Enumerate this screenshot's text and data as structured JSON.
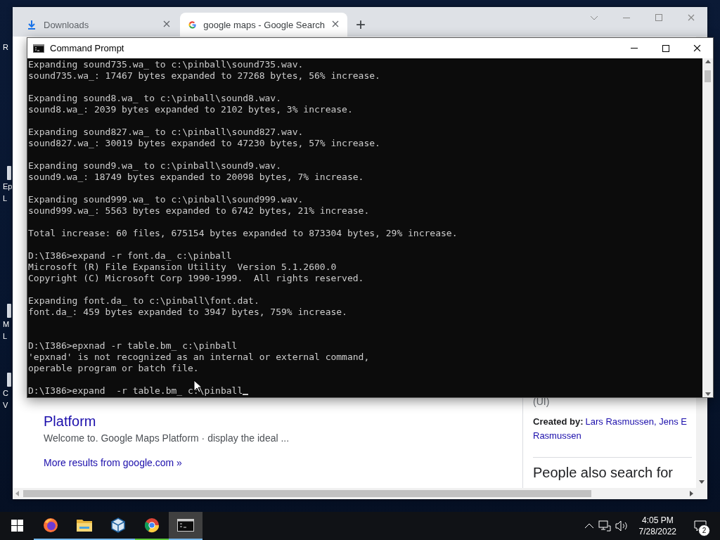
{
  "desktop_icons": [
    {
      "lines": [
        "R"
      ]
    },
    {
      "lines": [
        "Ep",
        "L"
      ]
    },
    {
      "lines": [
        "M",
        "L"
      ]
    },
    {
      "lines": [
        "C",
        "V"
      ]
    }
  ],
  "browser": {
    "tabs": [
      {
        "kind": "download",
        "title": "Downloads",
        "selected": false
      },
      {
        "kind": "google",
        "title": "google maps - Google Search",
        "selected": true
      }
    ],
    "new_tab": "+",
    "results": {
      "title": "Platform",
      "snippet": "Welcome to. Google Maps Platform · display the ideal ...",
      "more": "More results from google.com »"
    },
    "panel": {
      "note": "(UI)",
      "created_label": "Created by:",
      "creators": "Lars Rasmussen, Jens E",
      "creators_cont": "Rasmussen",
      "people_heading": "People also search for"
    }
  },
  "console": {
    "title": "Command Prompt",
    "lines": [
      {
        "kind": "text",
        "text": "Expanding sound735.wa_ to c:\\pinball\\sound735.wav."
      },
      {
        "kind": "text",
        "text": "sound735.wa_: 17467 bytes expanded to 27268 bytes, 56% increase."
      },
      {
        "kind": "blank"
      },
      {
        "kind": "text",
        "text": "Expanding sound8.wa_ to c:\\pinball\\sound8.wav."
      },
      {
        "kind": "text",
        "text": "sound8.wa_: 2039 bytes expanded to 2102 bytes, 3% increase."
      },
      {
        "kind": "blank"
      },
      {
        "kind": "text",
        "text": "Expanding sound827.wa_ to c:\\pinball\\sound827.wav."
      },
      {
        "kind": "text",
        "text": "sound827.wa_: 30019 bytes expanded to 47230 bytes, 57% increase."
      },
      {
        "kind": "blank"
      },
      {
        "kind": "text",
        "text": "Expanding sound9.wa_ to c:\\pinball\\sound9.wav."
      },
      {
        "kind": "text",
        "text": "sound9.wa_: 18749 bytes expanded to 20098 bytes, 7% increase."
      },
      {
        "kind": "blank"
      },
      {
        "kind": "text",
        "text": "Expanding sound999.wa_ to c:\\pinball\\sound999.wav."
      },
      {
        "kind": "text",
        "text": "sound999.wa_: 5563 bytes expanded to 6742 bytes, 21% increase."
      },
      {
        "kind": "blank"
      },
      {
        "kind": "text",
        "text": "Total increase: 60 files, 675154 bytes expanded to 873304 bytes, 29% increase."
      },
      {
        "kind": "blank"
      },
      {
        "kind": "text",
        "text": "D:\\I386>expand -r font.da_ c:\\pinball"
      },
      {
        "kind": "text",
        "text": "Microsoft (R) File Expansion Utility  Version 5.1.2600.0"
      },
      {
        "kind": "text",
        "text": "Copyright (C) Microsoft Corp 1990-1999.  All rights reserved."
      },
      {
        "kind": "blank"
      },
      {
        "kind": "text",
        "text": "Expanding font.da_ to c:\\pinball\\font.dat."
      },
      {
        "kind": "text",
        "text": "font.da_: 459 bytes expanded to 3947 bytes, 759% increase."
      },
      {
        "kind": "blank"
      },
      {
        "kind": "blank"
      },
      {
        "kind": "text",
        "text": "D:\\I386>epxnad -r table.bm_ c:\\pinball"
      },
      {
        "kind": "text",
        "text": "'epxnad' is not recognized as an internal or external command,"
      },
      {
        "kind": "text",
        "text": "operable program or batch file."
      },
      {
        "kind": "blank"
      },
      {
        "kind": "prompt",
        "text": "D:\\I386>expand  -r table.bm_ c:\\pinball"
      }
    ]
  },
  "taskbar": {
    "apps": [
      {
        "kind": "firefox",
        "color": "#76b9ed",
        "active": false
      },
      {
        "kind": "folder",
        "color": "#76b9ed",
        "active": false
      },
      {
        "kind": "cube",
        "color": "#76b9ed",
        "active": false
      },
      {
        "kind": "chrome",
        "color": "#5cc93b",
        "active": false
      },
      {
        "kind": "console",
        "color": "#76b9ed",
        "active": true
      }
    ],
    "time": "4:05 PM",
    "date": "7/28/2022",
    "notifications": "2"
  }
}
